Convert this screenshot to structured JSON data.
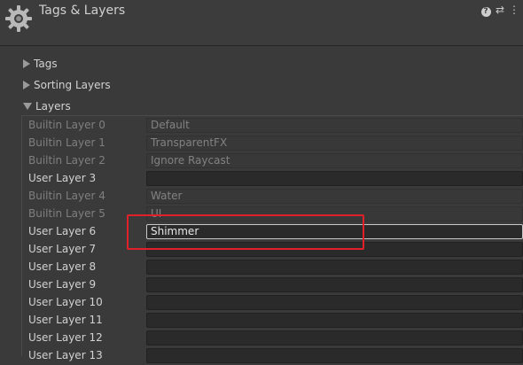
{
  "header": {
    "title": "Tags & Layers",
    "icons": [
      "help-icon",
      "preset-icon",
      "more-icon"
    ]
  },
  "sections": [
    {
      "label": "Tags",
      "expanded": false
    },
    {
      "label": "Sorting Layers",
      "expanded": false
    },
    {
      "label": "Layers",
      "expanded": true
    }
  ],
  "layers": [
    {
      "label": "Builtin Layer 0",
      "value": "Default",
      "editable": false
    },
    {
      "label": "Builtin Layer 1",
      "value": "TransparentFX",
      "editable": false
    },
    {
      "label": "Builtin Layer 2",
      "value": "Ignore Raycast",
      "editable": false
    },
    {
      "label": "User Layer 3",
      "value": "",
      "editable": true
    },
    {
      "label": "Builtin Layer 4",
      "value": "Water",
      "editable": false
    },
    {
      "label": "Builtin Layer 5",
      "value": "UI",
      "editable": false
    },
    {
      "label": "User Layer 6",
      "value": "Shimmer",
      "editable": true,
      "active": true
    },
    {
      "label": "User Layer 7",
      "value": "",
      "editable": true
    },
    {
      "label": "User Layer 8",
      "value": "",
      "editable": true
    },
    {
      "label": "User Layer 9",
      "value": "",
      "editable": true
    },
    {
      "label": "User Layer 10",
      "value": "",
      "editable": true
    },
    {
      "label": "User Layer 11",
      "value": "",
      "editable": true
    },
    {
      "label": "User Layer 12",
      "value": "",
      "editable": true
    },
    {
      "label": "User Layer 13",
      "value": "",
      "editable": true
    }
  ],
  "colors": {
    "highlight": "#e0212a"
  }
}
